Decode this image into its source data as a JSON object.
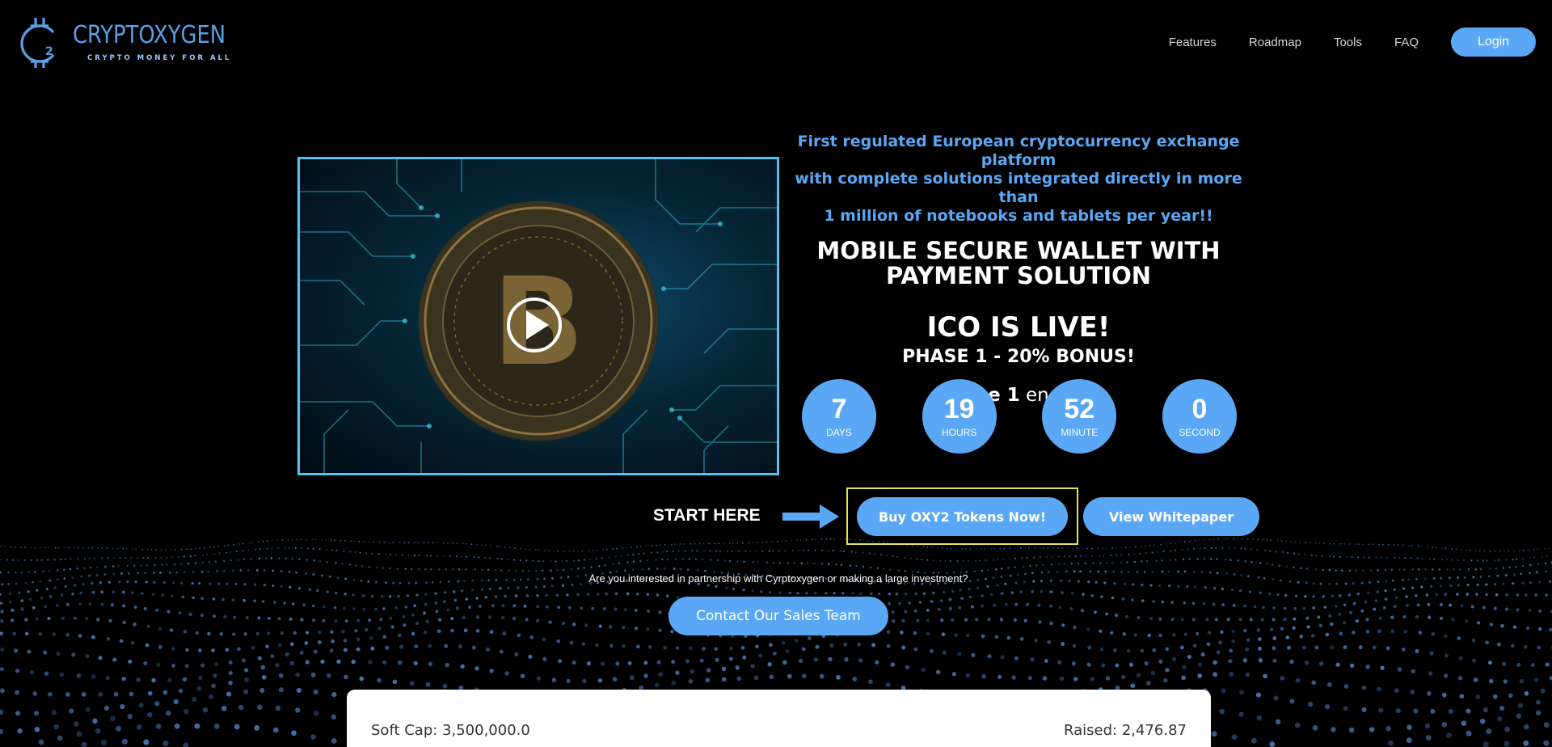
{
  "brand": {
    "name": "CRYPTOXYGEN",
    "tagline": "CRYPTO MONEY FOR ALL",
    "accent": "#5aa8f5"
  },
  "nav": {
    "items": [
      "Features",
      "Roadmap",
      "Tools",
      "FAQ"
    ],
    "login_label": "Login"
  },
  "video": {
    "icon": "play-icon"
  },
  "hero": {
    "subtitle_line1": "First regulated European cryptocurrency exchange platform",
    "subtitle_line2": "with complete solutions integrated directly in more than",
    "subtitle_line3": "1 million of notebooks and tablets per year!!",
    "title_line1": "MOBILE SECURE WALLET WITH",
    "title_line2": "PAYMENT SOLUTION",
    "ico_status": "ICO IS LIVE!",
    "phase_bonus": "PHASE 1 - 20% BONUS!",
    "phase_name": "Phase 1",
    "phase_ends": "ends in:"
  },
  "countdown": [
    {
      "value": "7",
      "label": "DAYS"
    },
    {
      "value": "19",
      "label": "HOURS"
    },
    {
      "value": "52",
      "label": "MINUTE"
    },
    {
      "value": "0",
      "label": "SECOND"
    }
  ],
  "cta": {
    "start_here": "START HERE",
    "buy_label": "Buy OXY2 Tokens Now!",
    "whitepaper_label": "View Whitepaper",
    "partner_text": "Are you interested in partnership with Cyrptoxygen or making a large investment?",
    "sales_label": "Contact Our Sales Team"
  },
  "caps": {
    "soft_cap": "Soft Cap: 3,500,000.0",
    "raised": "Raised: 2,476.87"
  }
}
